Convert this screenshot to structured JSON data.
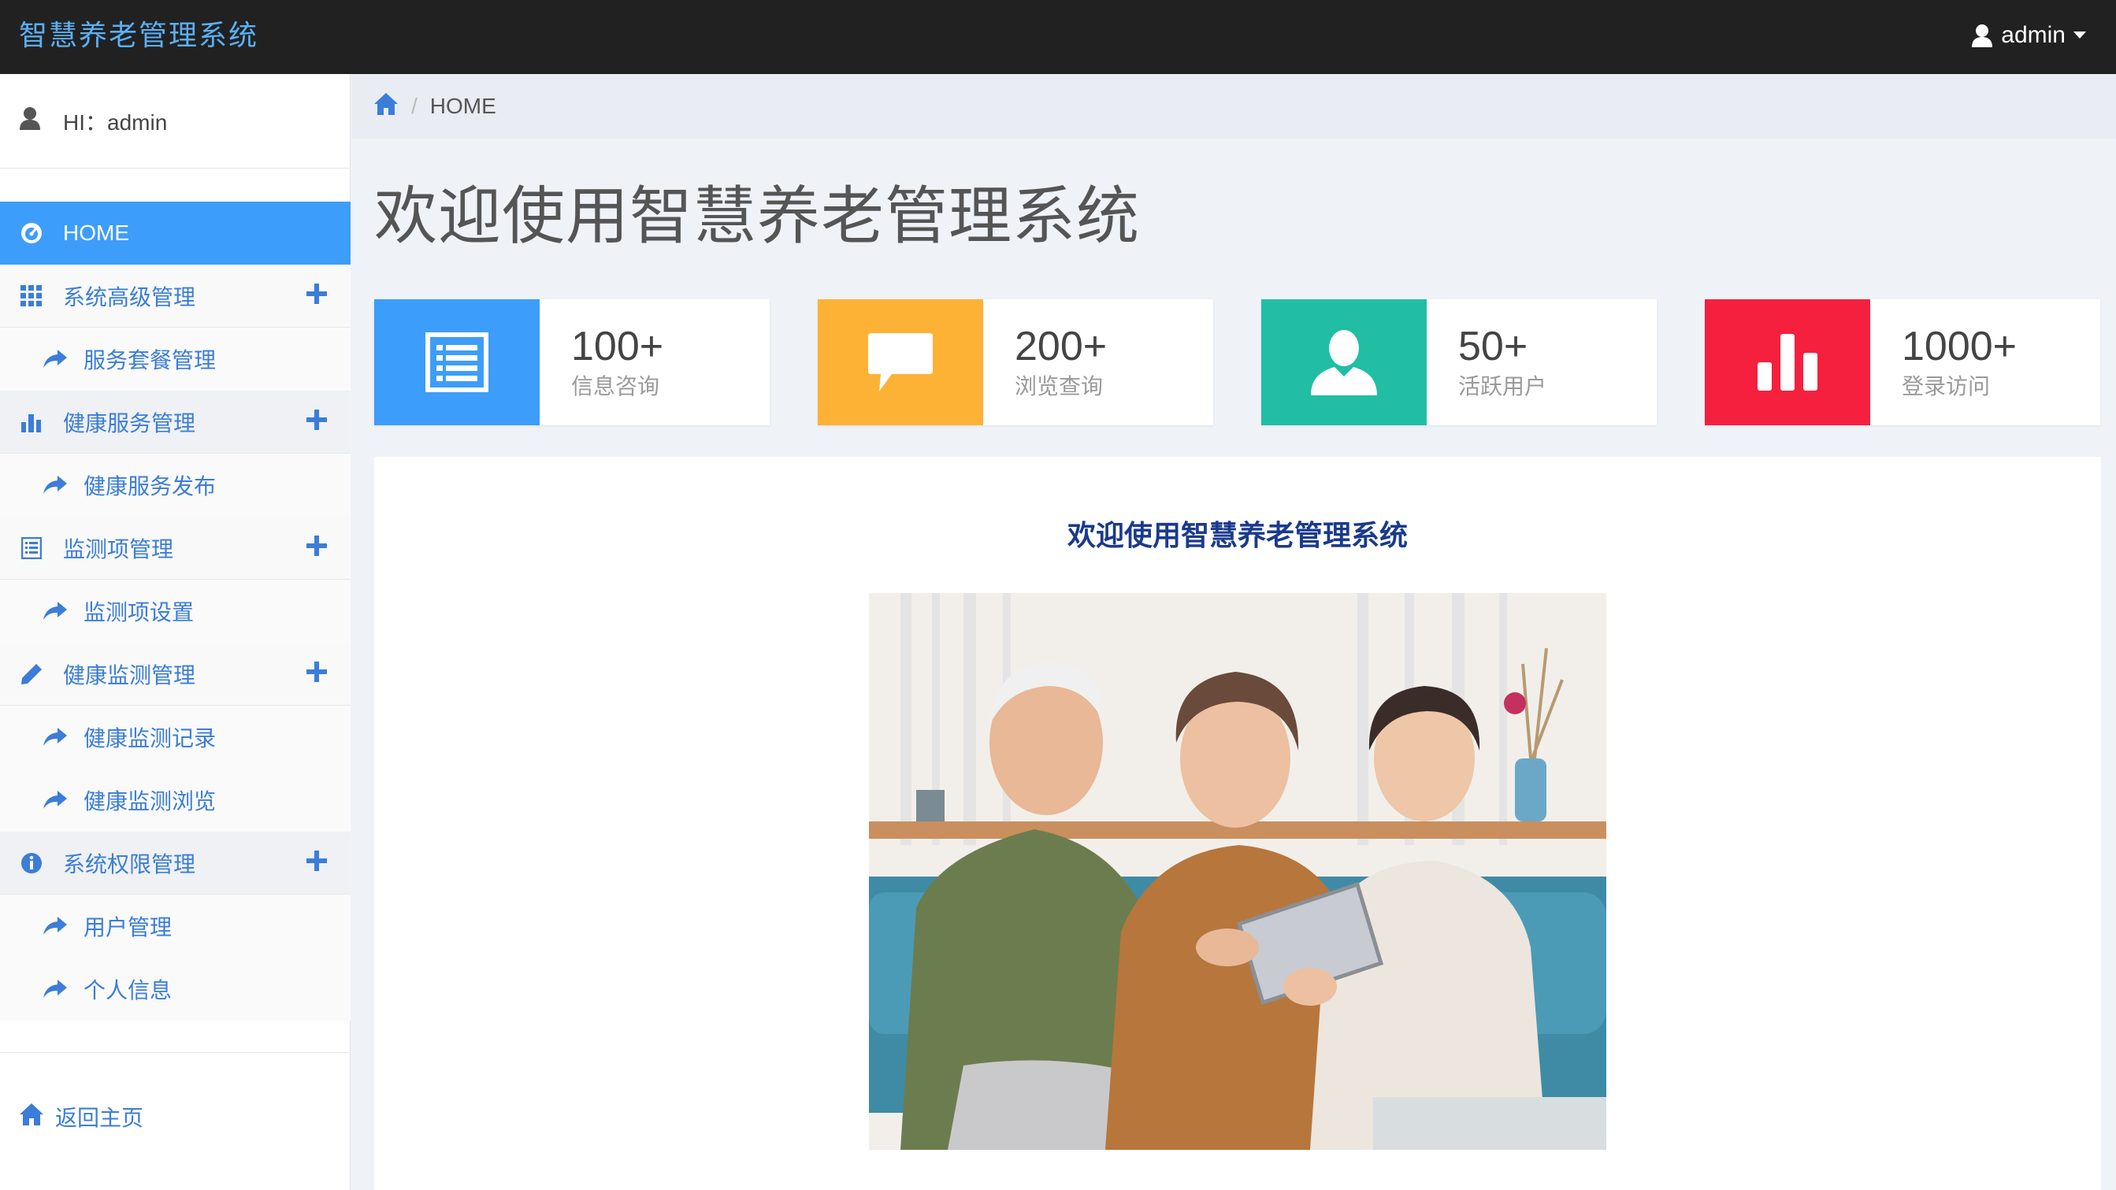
{
  "navbar": {
    "brand": "智慧养老管理系统",
    "user": "admin"
  },
  "sidebar": {
    "greeting": "HI：admin",
    "menu": [
      {
        "label": "HOME",
        "icon": "dashboard-icon",
        "active": true
      },
      {
        "label": "系统高级管理",
        "icon": "grid-icon",
        "children": [
          {
            "label": "服务套餐管理"
          }
        ]
      },
      {
        "label": "健康服务管理",
        "icon": "bar-chart-icon",
        "children": [
          {
            "label": "健康服务发布"
          }
        ]
      },
      {
        "label": "监测项管理",
        "icon": "list-icon",
        "children": [
          {
            "label": "监测项设置"
          }
        ]
      },
      {
        "label": "健康监测管理",
        "icon": "pencil-icon",
        "children": [
          {
            "label": "健康监测记录"
          },
          {
            "label": "健康监测浏览"
          }
        ]
      },
      {
        "label": "系统权限管理",
        "icon": "info-icon",
        "children": [
          {
            "label": "用户管理"
          },
          {
            "label": "个人信息"
          }
        ]
      }
    ],
    "back_home": "返回主页"
  },
  "breadcrumb": {
    "current": "HOME"
  },
  "page_title": "欢迎使用智慧养老管理系统",
  "stats": [
    {
      "value": "100+",
      "label": "信息咨询",
      "color": "#3d9dfa",
      "icon": "list-icon"
    },
    {
      "value": "200+",
      "label": "浏览查询",
      "color": "#fdb236",
      "icon": "comment-icon"
    },
    {
      "value": "50+",
      "label": "活跃用户",
      "color": "#21bea3",
      "icon": "user-icon"
    },
    {
      "value": "1000+",
      "label": "登录访问",
      "color": "#f5203e",
      "icon": "bar-chart-icon"
    }
  ],
  "content": {
    "heading": "欢迎使用智慧养老管理系统"
  },
  "colors": {
    "navbar": "#212121",
    "brand": "#5ab0f5",
    "accent": "#3d9dfa",
    "link": "#3b7dd8"
  }
}
